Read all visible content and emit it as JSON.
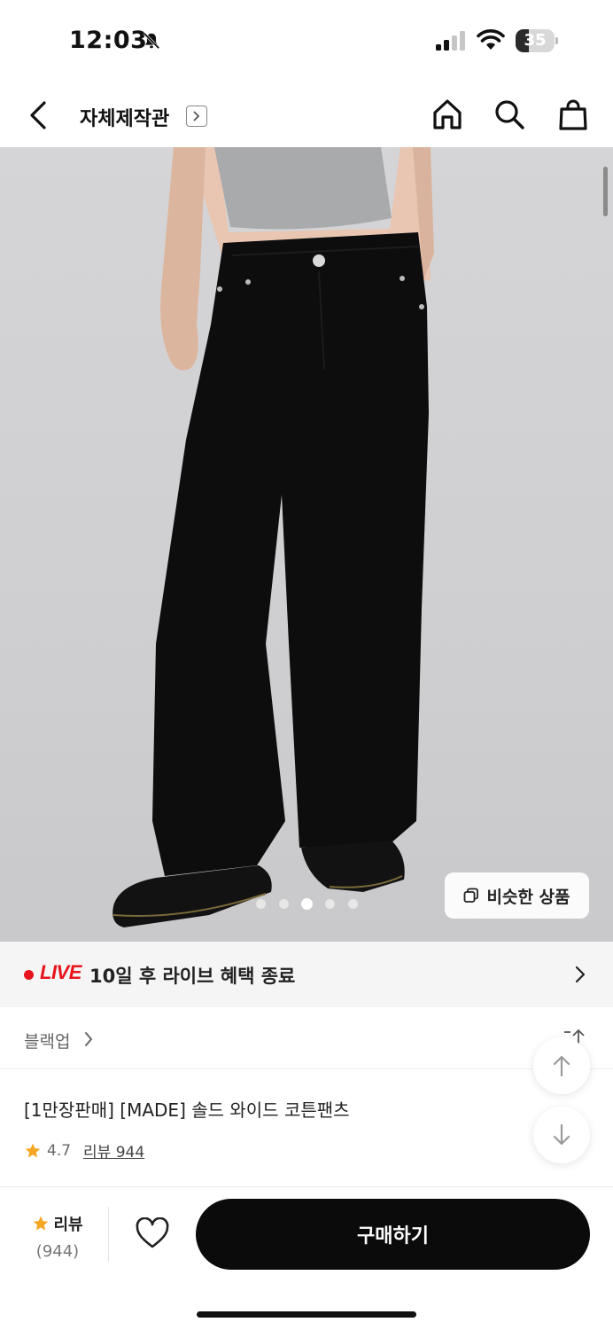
{
  "status": {
    "time": "12:03",
    "battery": "35",
    "battery_level": 0.35
  },
  "nav": {
    "store_name": "자체제작관"
  },
  "gallery": {
    "similar_label": "비슷한 상품",
    "page_count": 5,
    "current_page": 3
  },
  "live": {
    "label": "LIVE",
    "text": "10일 후 라이브 혜택 종료"
  },
  "brand": {
    "name": "블랙업"
  },
  "product": {
    "title": "[1만장판매] [MADE] 솔드 와이드 코튼팬츠",
    "rating": "4.7",
    "review_link": "리뷰 944"
  },
  "bottom_bar": {
    "review_label": "리뷰",
    "review_count": "(944)",
    "buy_label": "구매하기"
  },
  "colors": {
    "accent_red": "#e8141b",
    "star": "#f5a623",
    "buy_bg": "#0b0b0b"
  }
}
